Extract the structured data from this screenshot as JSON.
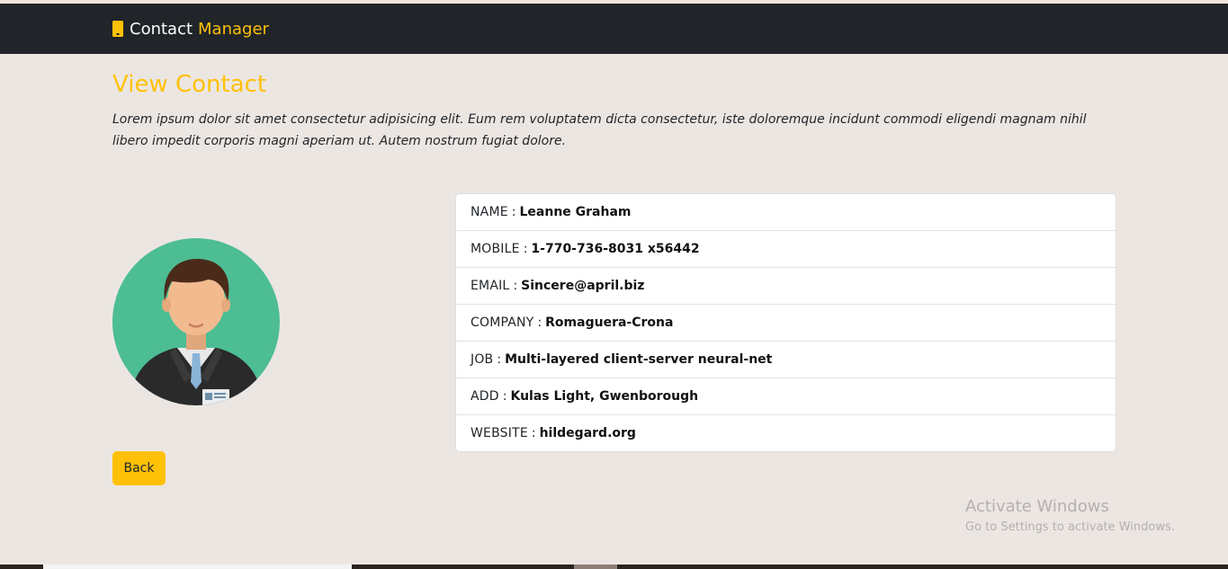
{
  "navbar": {
    "brand_primary": "Contact",
    "brand_accent": "Manager",
    "brand_icon": "phone-icon"
  },
  "header": {
    "title": "View Contact",
    "description": "Lorem ipsum dolor sit amet consectetur adipisicing elit. Eum rem voluptatem dicta consectetur, iste doloremque incidunt commodi eligendi magnam nihil libero impedit corporis magni aperiam ut. Autem nostrum fugiat dolore."
  },
  "contact": {
    "avatar_icon": "person-avatar-icon",
    "fields": [
      {
        "label": "NAME",
        "value": "Leanne Graham"
      },
      {
        "label": "MOBILE",
        "value": "1-770-736-8031 x56442"
      },
      {
        "label": "EMAIL",
        "value": "Sincere@april.biz"
      },
      {
        "label": "COMPANY",
        "value": "Romaguera-Crona"
      },
      {
        "label": "JOB",
        "value": "Multi-layered client-server neural-net"
      },
      {
        "label": "ADD",
        "value": "Kulas Light, Gwenborough"
      },
      {
        "label": "WEBSITE",
        "value": "hildegard.org"
      }
    ]
  },
  "actions": {
    "back_label": "Back"
  },
  "watermark": {
    "line1": "Activate Windows",
    "line2": "Go to Settings to activate Windows."
  },
  "colors": {
    "accent": "#ffc107",
    "navbar_bg": "#212529",
    "page_bg": "#ece6e2",
    "avatar_bg": "#4dbd94"
  }
}
